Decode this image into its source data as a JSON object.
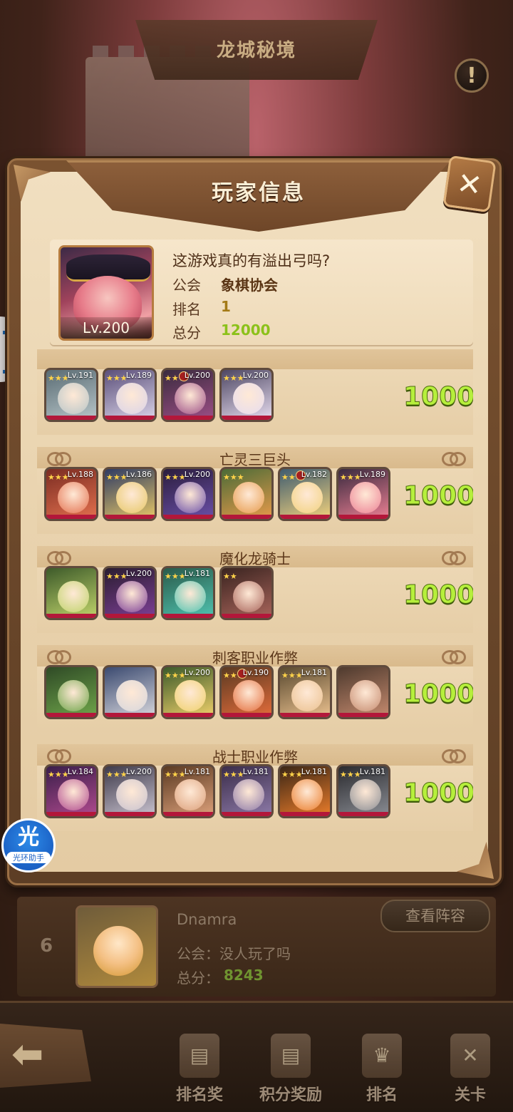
{
  "scene": {
    "title": "龙城秘境",
    "info_icon": "exclamation-icon"
  },
  "modal": {
    "title": "玩家信息",
    "close_icon": "close-x-icon"
  },
  "player": {
    "name": "这游戏真的有溢出弓吗?",
    "level": "Lv.200",
    "guild_label": "公会",
    "guild": "象棋协会",
    "rank_label": "排名",
    "rank": "1",
    "score_label": "总分",
    "score": "12000"
  },
  "teams": [
    {
      "name": "",
      "score": "1000",
      "heroes": [
        {
          "level": "Lv.191",
          "stars": "★★★",
          "colors": [
            "#5a6c74",
            "#b7c5c8"
          ],
          "badge": false
        },
        {
          "level": "Lv.189",
          "stars": "★★★",
          "colors": [
            "#5b4f7a",
            "#d9d3e8"
          ],
          "badge": false
        },
        {
          "level": "Lv.200",
          "stars": "★★★",
          "colors": [
            "#3a2b3e",
            "#9c4e86"
          ],
          "badge": true
        },
        {
          "level": "Lv.200",
          "stars": "★★★",
          "colors": [
            "#4e4763",
            "#e6dcef"
          ],
          "badge": false
        }
      ]
    },
    {
      "name": "亡灵三巨头",
      "score": "1000",
      "heroes": [
        {
          "level": "Lv.188",
          "stars": "★★★",
          "colors": [
            "#7a2c22",
            "#e3704e"
          ],
          "badge": false
        },
        {
          "level": "Lv.186",
          "stars": "★★★",
          "colors": [
            "#2f3b63",
            "#e6c766"
          ],
          "badge": false
        },
        {
          "level": "Lv.200",
          "stars": "★★★",
          "colors": [
            "#2b1d3d",
            "#6a4fa8"
          ],
          "badge": false
        },
        {
          "level": "",
          "stars": "★★★",
          "colors": [
            "#4b6b37",
            "#e69a4a"
          ],
          "badge": false
        },
        {
          "level": "Lv.182",
          "stars": "★★★",
          "colors": [
            "#3f5c70",
            "#f1d17c"
          ],
          "badge": true
        },
        {
          "level": "Lv.189",
          "stars": "★★★",
          "colors": [
            "#3a2a3e",
            "#ec8094"
          ],
          "badge": false
        }
      ]
    },
    {
      "name": "魔化龙骑士",
      "score": "1000",
      "heroes": [
        {
          "level": "",
          "stars": "",
          "colors": [
            "#3d5a2a",
            "#bfd36a"
          ],
          "badge": false
        },
        {
          "level": "Lv.200",
          "stars": "★★★",
          "colors": [
            "#2a1d30",
            "#7d3f96"
          ],
          "badge": false
        },
        {
          "level": "Lv.181",
          "stars": "★★★",
          "colors": [
            "#2a5a4a",
            "#4fc3b0"
          ],
          "badge": false
        },
        {
          "level": "",
          "stars": "★★",
          "colors": [
            "#3a2420",
            "#a8645a"
          ],
          "badge": false
        }
      ]
    },
    {
      "name": "刺客职业作弊",
      "score": "1000",
      "heroes": [
        {
          "level": "",
          "stars": "",
          "colors": [
            "#2f4a26",
            "#6fa54a"
          ],
          "badge": false
        },
        {
          "level": "",
          "stars": "",
          "colors": [
            "#3b4a70",
            "#d6d6dc"
          ],
          "badge": false
        },
        {
          "level": "Lv.200",
          "stars": "★★★",
          "colors": [
            "#3c5a2a",
            "#efd06a"
          ],
          "badge": false
        },
        {
          "level": "Lv.190",
          "stars": "★★★",
          "colors": [
            "#5b3a22",
            "#e36c3a"
          ],
          "badge": true
        },
        {
          "level": "Lv.181",
          "stars": "★★★",
          "colors": [
            "#5a4a30",
            "#eac08e"
          ],
          "badge": false
        },
        {
          "level": "",
          "stars": "",
          "colors": [
            "#4e3a2e",
            "#c58a6e"
          ],
          "badge": false
        }
      ]
    },
    {
      "name": "战士职业作弊",
      "score": "1000",
      "heroes": [
        {
          "level": "Lv.184",
          "stars": "★★★",
          "colors": [
            "#3a1e4a",
            "#b04a8e"
          ],
          "badge": false
        },
        {
          "level": "Lv.200",
          "stars": "★★★",
          "colors": [
            "#3e3a4a",
            "#c8c2cf"
          ],
          "badge": false
        },
        {
          "level": "Lv.181",
          "stars": "★★★",
          "colors": [
            "#5a3a22",
            "#dca07a"
          ],
          "badge": false
        },
        {
          "level": "Lv.181",
          "stars": "★★★",
          "colors": [
            "#3b2d4a",
            "#8d7aa8"
          ],
          "badge": false
        },
        {
          "level": "Lv.181",
          "stars": "★★★",
          "colors": [
            "#3a2616",
            "#ea7c2a"
          ],
          "badge": false
        },
        {
          "level": "Lv.181",
          "stars": "★★★",
          "colors": [
            "#2a2a2e",
            "#8a8d94"
          ],
          "badge": false
        }
      ]
    }
  ],
  "ranking_entry": {
    "rank": "6",
    "name": "Dnamra",
    "guild_line": "公会：没人玩了吗",
    "score_label": "总分：",
    "score": "8243",
    "view_button": "查看阵容"
  },
  "assistant": {
    "glyph": "光",
    "label": "光环助手"
  },
  "nav": {
    "back_icon": "back-arrow-icon",
    "items": [
      {
        "label": "排名奖",
        "icon": "scroll-icon",
        "glyph": "▤"
      },
      {
        "label": "积分奖励",
        "icon": "scroll-icon",
        "glyph": "▤"
      },
      {
        "label": "排名",
        "icon": "trophy-icon",
        "glyph": "♛"
      },
      {
        "label": "关卡",
        "icon": "crossed-swords-icon",
        "glyph": "✕"
      }
    ]
  }
}
